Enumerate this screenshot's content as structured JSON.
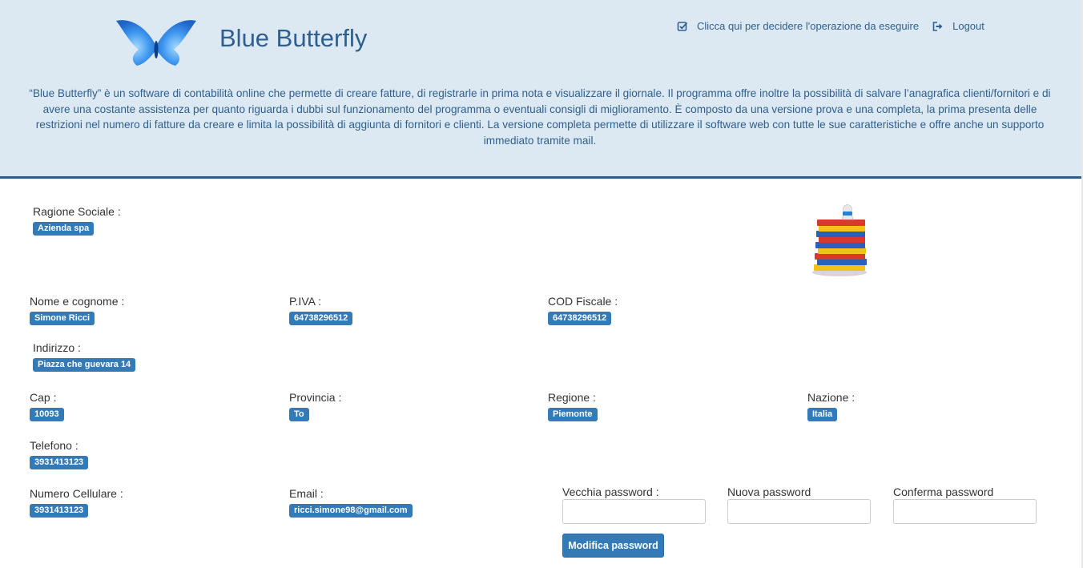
{
  "app": {
    "title": "Blue Butterfly",
    "description": "“Blue Butterfly” è un software di contabilità online che permette di creare fatture, di registrarle in prima nota e visualizzare il giornale. Il programma offre inoltre la possibilità di salvare l’anagrafica clienti/fornitori e di avere una costante assistenza per quanto riguarda i dubbi sul funzionamento del programma o eventuali consigli di miglioramento. È composto da una versione prova e una completa, la prima presenta delle restrizioni nel numero di fatture da creare e limita la possibilità di aggiunta di fornitori e clienti. La versione completa permette di utilizzare il software web con tutte le sue caratteristiche e offre anche un supporto immediato tramite mail."
  },
  "nav": {
    "choose_operation": "Clicca qui per decidere l'operazione da eseguire",
    "logout": "Logout"
  },
  "profile": {
    "ragione_sociale": {
      "label": "Ragione Sociale :",
      "value": "Azienda spa"
    },
    "nome_cognome": {
      "label": "Nome e cognome :",
      "value": "Simone Ricci"
    },
    "piva": {
      "label": "P.IVA :",
      "value": "64738296512"
    },
    "cod_fiscale": {
      "label": "COD Fiscale :",
      "value": "64738296512"
    },
    "indirizzo": {
      "label": "Indirizzo :",
      "value": "Piazza che guevara 14"
    },
    "cap": {
      "label": "Cap :",
      "value": "10093"
    },
    "provincia": {
      "label": "Provincia :",
      "value": "To"
    },
    "regione": {
      "label": "Regione :",
      "value": "Piemonte"
    },
    "nazione": {
      "label": "Nazione :",
      "value": "Italia"
    },
    "telefono": {
      "label": "Telefono :",
      "value": "3931413123"
    },
    "cellulare": {
      "label": "Numero Cellulare :",
      "value": "3931413123"
    },
    "email": {
      "label": "Email :",
      "value": "ricci.simone98@gmail.com"
    }
  },
  "password": {
    "old_label": "Vecchia password :",
    "new_label": "Nuova password",
    "confirm_label": "Conferma password",
    "old_value": "",
    "new_value": "",
    "confirm_value": "",
    "submit_label": "Modifica password"
  },
  "colors": {
    "header_bg": "#dde9f2",
    "accent": "#2e5f8e",
    "badge": "#337ab7"
  },
  "icons": {
    "logo": "butterfly-logo-icon",
    "choose_operation": "check-square-icon",
    "logout": "logout-icon",
    "illustration": "book-stack-icon"
  }
}
